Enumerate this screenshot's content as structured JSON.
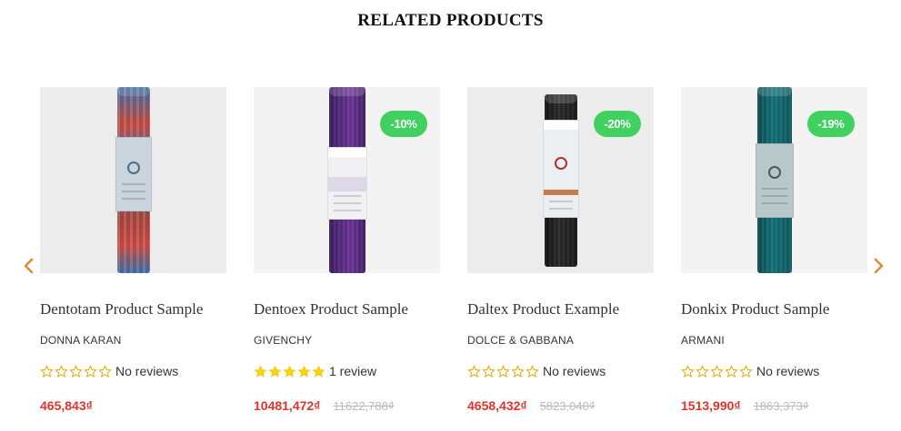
{
  "section": {
    "title": "RELATED PRODUCTS"
  },
  "colors": {
    "sale_badge": "#41d160",
    "price": "#e0332e",
    "star_filled": "#ffd400",
    "star_empty": "#e0a800"
  },
  "products": [
    {
      "name": "Dentotam Product Sample",
      "brand": "DONNA KARAN",
      "rating": 0,
      "reviews": "No reviews",
      "price": "465,843₫",
      "old_price": "",
      "badge": ""
    },
    {
      "name": "Dentoex Product Sample",
      "brand": "GIVENCHY",
      "rating": 5,
      "reviews": "1 review",
      "price": "10481,472₫",
      "old_price": "11622,788₫",
      "badge": "-10%"
    },
    {
      "name": "Daltex Product Example",
      "brand": "DOLCE & GABBANA",
      "rating": 0,
      "reviews": "No reviews",
      "price": "4658,432₫",
      "old_price": "5823,040₫",
      "badge": "-20%"
    },
    {
      "name": "Donkix Product Sample",
      "brand": "ARMANI",
      "rating": 0,
      "reviews": "No reviews",
      "price": "1513,990₫",
      "old_price": "1863,373₫",
      "badge": "-19%"
    }
  ],
  "icons": {
    "prev": "chevron-left-icon",
    "next": "chevron-right-icon"
  }
}
